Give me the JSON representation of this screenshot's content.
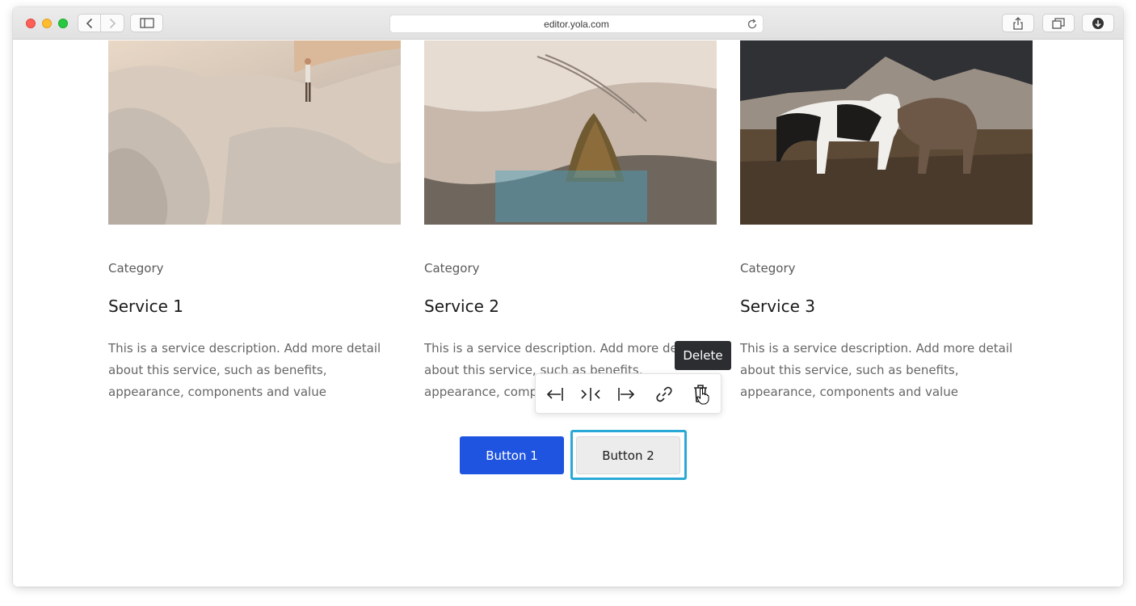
{
  "browser": {
    "url": "editor.yola.com"
  },
  "cards": [
    {
      "category": "Category",
      "title": "Service 1",
      "description": "This is a service description. Add more detail about this service, such as benefits, appearance, components and value"
    },
    {
      "category": "Category",
      "title": "Service 2",
      "description": "This is a service description. Add more detail about this service, such as benefits, appearance, components and value"
    },
    {
      "category": "Category",
      "title": "Service 3",
      "description": "This is a service description. Add more detail about this service, such as benefits, appearance, components and value"
    }
  ],
  "buttons": {
    "button1": "Button 1",
    "button2": "Button 2"
  },
  "toolbar": {
    "tools": [
      "align-left-icon",
      "align-center-icon",
      "align-right-icon",
      "link-icon",
      "trash-icon"
    ],
    "tooltip": "Delete"
  },
  "colors": {
    "primary_button": "#1f54e0",
    "selection_outline": "#2aa8d6",
    "tooltip_bg": "#2b2d31"
  }
}
